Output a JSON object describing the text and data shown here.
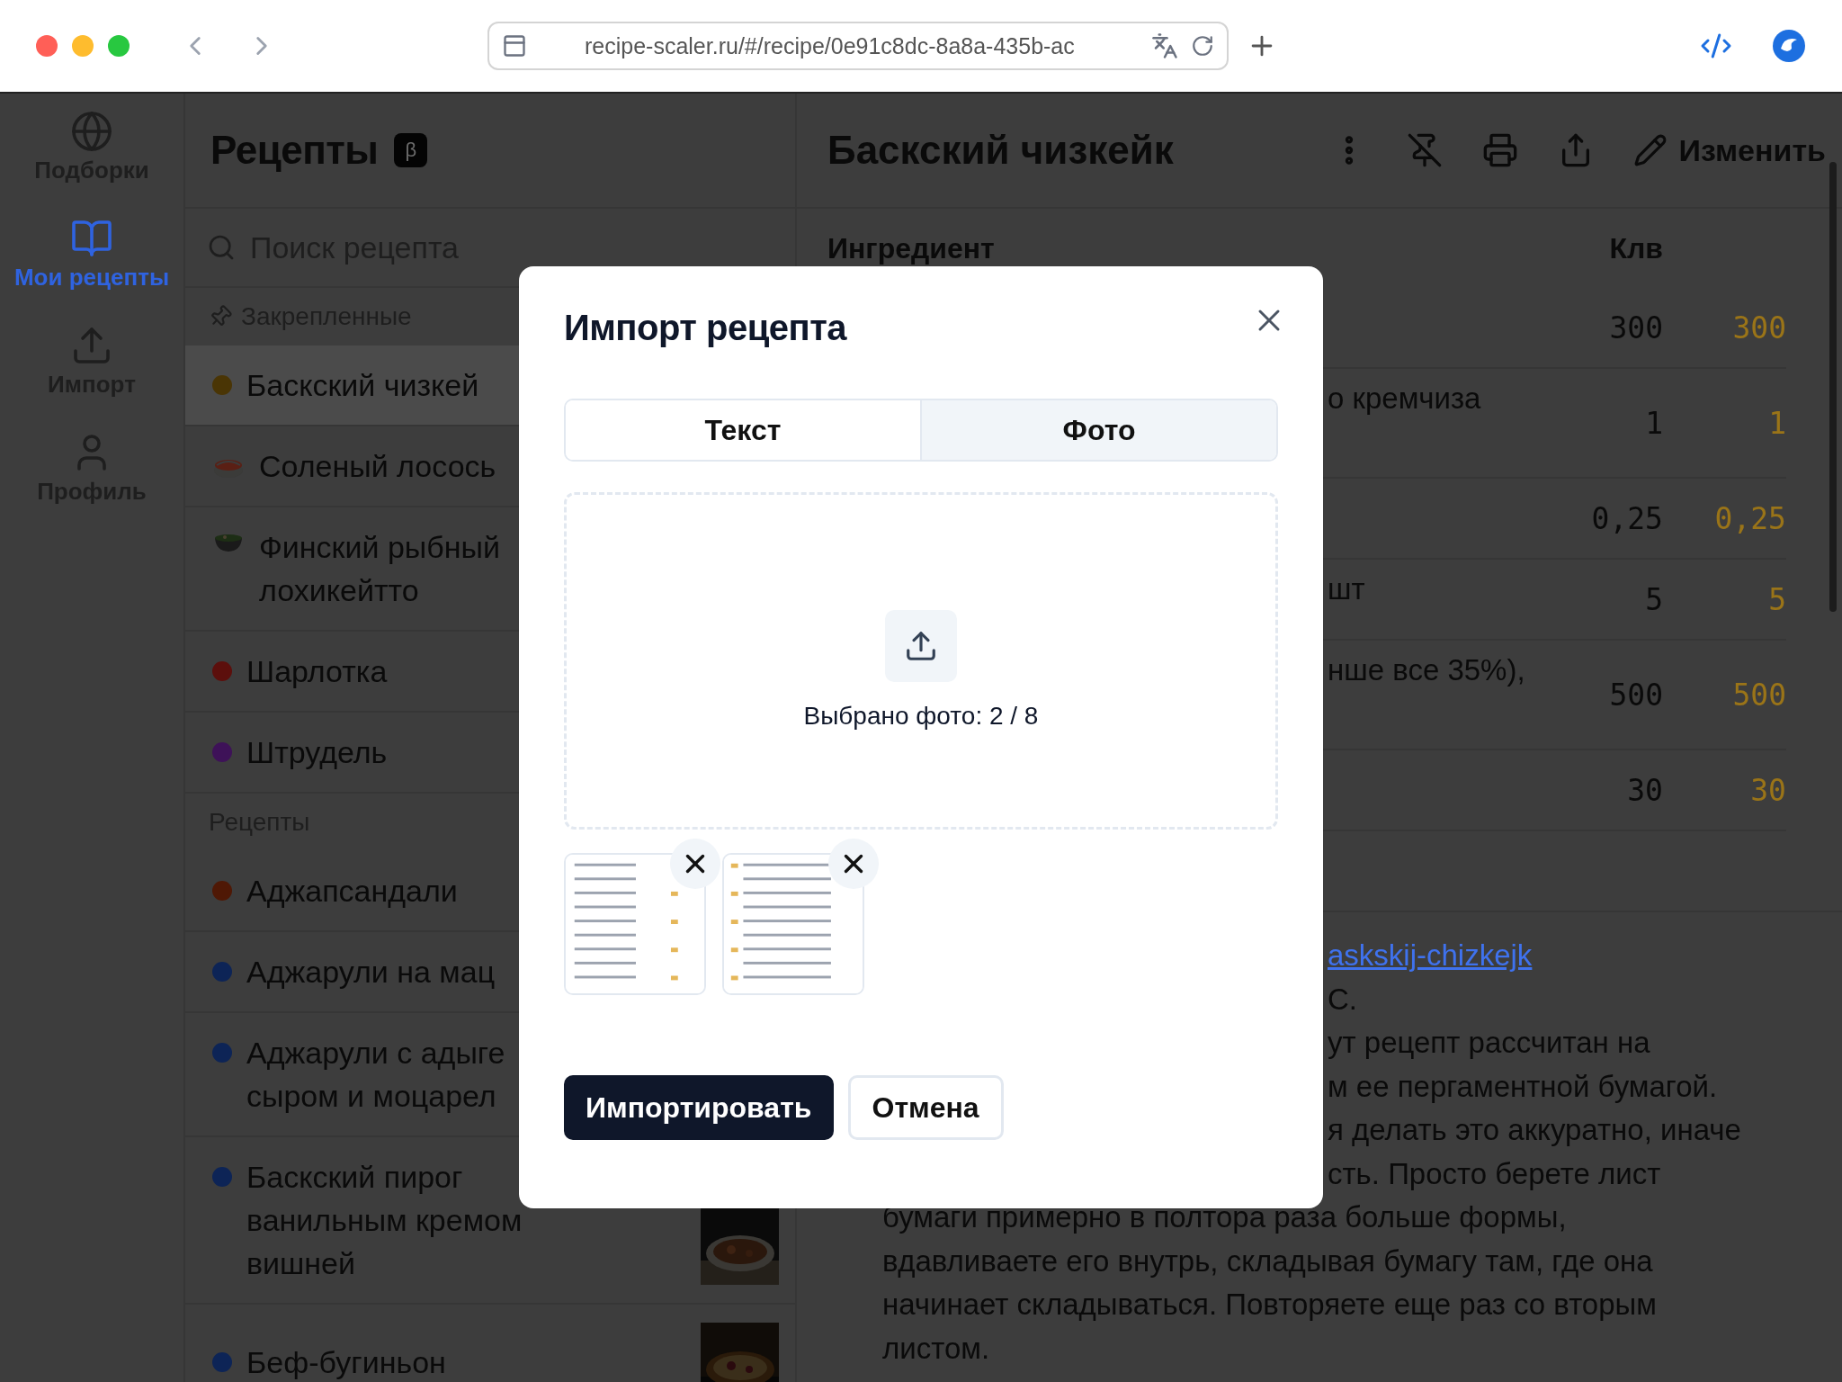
{
  "browser": {
    "url": "recipe-scaler.ru/#/recipe/0e91c8dc-8a8a-435b-ac"
  },
  "nav": [
    {
      "label": "Подборки",
      "selected": false
    },
    {
      "label": "Мои рецепты",
      "selected": true
    },
    {
      "label": "Импорт",
      "selected": false
    },
    {
      "label": "Профиль",
      "selected": false
    }
  ],
  "list": {
    "title": "Рецепты",
    "badge": "β",
    "search": {
      "placeholder": "Поиск рецепта"
    },
    "sections": [
      {
        "title": "Закрепленные",
        "pinned": true,
        "items": [
          {
            "lines": [
              "Баскский чизкей"
            ],
            "marker": {
              "kind": "dot",
              "color": "#4a3505"
            },
            "selected": true
          },
          {
            "lines": [
              "Соленый лосось"
            ],
            "marker": {
              "kind": "sushi"
            },
            "selected": false
          },
          {
            "lines": [
              "Финский рыбный",
              "лохикейтто"
            ],
            "marker": {
              "kind": "soup"
            },
            "selected": false
          },
          {
            "lines": [
              "Шарлотка"
            ],
            "marker": {
              "kind": "dot",
              "color": "#5c0f0c"
            },
            "selected": false
          },
          {
            "lines": [
              "Штрудель"
            ],
            "marker": {
              "kind": "dot",
              "color": "#3e1258"
            },
            "selected": false
          }
        ]
      },
      {
        "title": "Рецепты",
        "pinned": false,
        "items": [
          {
            "lines": [
              "Аджапсандали"
            ],
            "marker": {
              "kind": "dot",
              "color": "#4f1805"
            },
            "selected": false
          },
          {
            "lines": [
              "Аджарули на мац"
            ],
            "marker": {
              "kind": "dot",
              "color": "#0d2456"
            },
            "selected": false
          },
          {
            "lines": [
              "Аджарули с адыге",
              "сыром и моцарел"
            ],
            "marker": {
              "kind": "dot",
              "color": "#0d2456"
            },
            "selected": false
          },
          {
            "lines": [
              "Баскский пирог",
              "ванильным кремом",
              "вишней"
            ],
            "marker": {
              "kind": "dot",
              "color": "#0d2456"
            },
            "selected": false,
            "thumbnail": {
              "kind": "picture"
            }
          },
          {
            "lines": [
              "Беф-бугиньон"
            ],
            "marker": {
              "kind": "dot",
              "color": "#0d2456"
            },
            "selected": false,
            "thumbnail": {
              "kind": "picture"
            }
          }
        ]
      }
    ]
  },
  "recipe": {
    "title": "Баскский чизкейк",
    "edit": "Изменить",
    "columns": [
      "Ингредиент",
      "Клв"
    ],
    "rows": [
      {
        "qty": "300",
        "scaled": "300"
      },
      {
        "ingredient": "о кремчиза",
        "qty": "1",
        "scaled": "1"
      },
      {
        "qty": "0,25",
        "scaled": "0,25"
      },
      {
        "ingredient": "шт",
        "qty": "5",
        "scaled": "5"
      },
      {
        "ingredient": "нше все 35%),",
        "qty": "500",
        "scaled": "500"
      },
      {
        "qty": "30",
        "scaled": "30"
      }
    ],
    "link": "askskij-chizkejk",
    "source": "С.",
    "note_partial": [
      "ут рецепт рассчитан на",
      "м ее пергаментной бумагой.",
      "я делать это аккуратно, иначе",
      "сть. Просто берете лист"
    ],
    "note_lines": [
      "бумаги примерно в полтора раза больше формы,",
      "вдавливаете его внутрь, складывая бумагу там, где она",
      "начинает складываться. Повторяете еще раз со вторым",
      "листом."
    ]
  },
  "modal": {
    "title": "Импорт рецепта",
    "tabs": [
      {
        "label": "Текст",
        "selected": false
      },
      {
        "label": "Фото",
        "selected": true
      }
    ],
    "dropzone": {
      "status": "Выбрано фото: 2 / 8"
    },
    "photos": [
      {
        "kind": "picture"
      },
      {
        "kind": "picture"
      }
    ],
    "buttons": [
      {
        "label": "Импортировать",
        "kind": "primary"
      },
      {
        "label": "Отмена",
        "kind": "secondary"
      }
    ]
  }
}
